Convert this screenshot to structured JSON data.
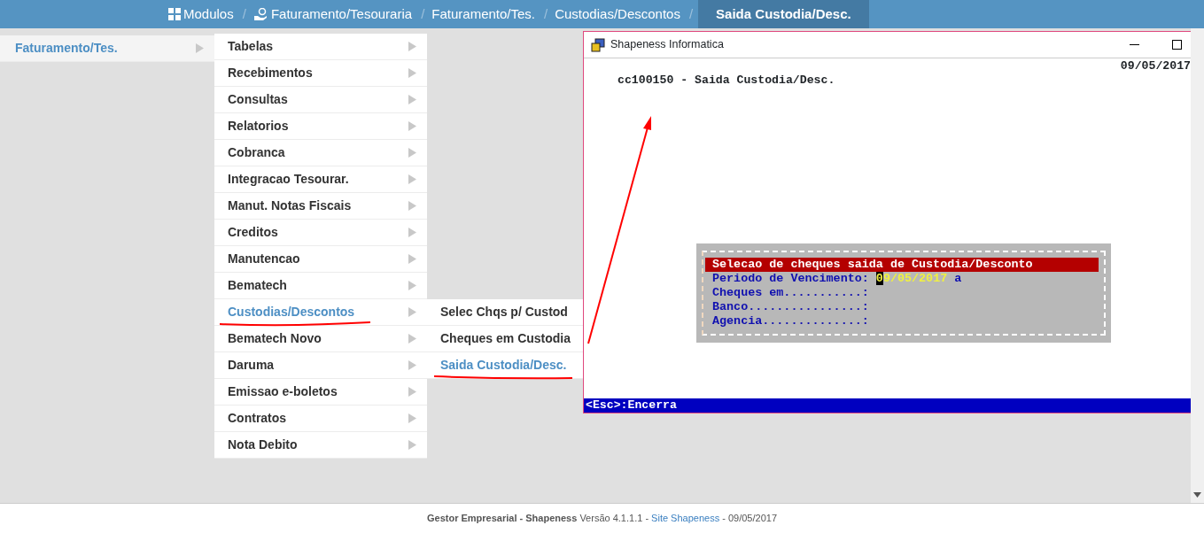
{
  "breadcrumb": [
    {
      "label": "Modulos",
      "separator": "/",
      "selected": false
    },
    {
      "label": "Faturamento/Tesouraria",
      "separator": "/",
      "selected": false
    },
    {
      "label": "Faturamento/Tes.",
      "separator": "/",
      "selected": false
    },
    {
      "label": "Custodias/Descontos",
      "separator": "/",
      "selected": false
    },
    {
      "label": "Saida Custodia/Desc.",
      "selected": true
    }
  ],
  "menu_level1": [
    {
      "label": "Faturamento/Tes.",
      "selected": true
    }
  ],
  "menu_level2": [
    {
      "label": "Tabelas",
      "selected": false
    },
    {
      "label": "Recebimentos",
      "selected": false
    },
    {
      "label": "Consultas",
      "selected": false
    },
    {
      "label": "Relatorios",
      "selected": false
    },
    {
      "label": "Cobranca",
      "selected": false
    },
    {
      "label": "Integracao Tesourar.",
      "selected": false
    },
    {
      "label": "Manut. Notas Fiscais",
      "selected": false
    },
    {
      "label": "Creditos",
      "selected": false
    },
    {
      "label": "Manutencao",
      "selected": false
    },
    {
      "label": "Bematech",
      "selected": false
    },
    {
      "label": "Custodias/Descontos",
      "selected": true
    },
    {
      "label": "Bematech Novo",
      "selected": false
    },
    {
      "label": "Daruma",
      "selected": false
    },
    {
      "label": "Emissao e-boletos",
      "selected": false
    },
    {
      "label": "Contratos",
      "selected": false
    },
    {
      "label": "Nota Debito",
      "selected": false
    }
  ],
  "menu_level3": [
    {
      "label": "Selec Chqs p/ Custod",
      "selected": false
    },
    {
      "label": "Cheques em Custodia",
      "selected": false
    },
    {
      "label": "Saida Custodia/Desc.",
      "selected": true
    }
  ],
  "window": {
    "title": "Shapeness Informatica",
    "terminal": {
      "date": "09/05/2017",
      "program_title": "cc100150 - Saida Custodia/Desc.",
      "dialog": {
        "title": "Selecao de cheques saida de Custodia/Desconto",
        "fields": [
          {
            "label": "Periodo de Vencimento:",
            "value": "09/05/2017",
            "suffix": "a",
            "focused": true
          },
          {
            "label": "Cheques em...........:"
          },
          {
            "label": "Banco................:"
          },
          {
            "label": "Agencia..............:"
          }
        ]
      },
      "status_line": "<Esc>:Encerra"
    }
  },
  "footer": {
    "text_before": "**Gestor Empresarial - Shapeness** Versão 4.1.1.1 - ",
    "link": "Site Shapeness",
    "text_after": " - 09/05/2017"
  }
}
